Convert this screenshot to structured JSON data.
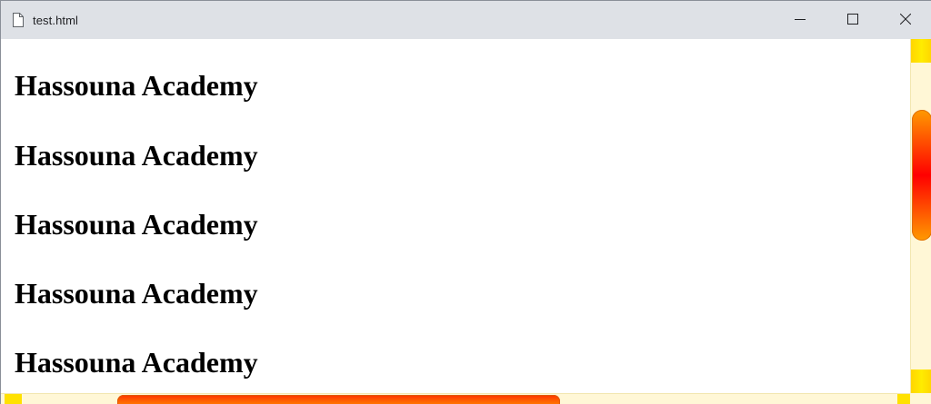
{
  "window": {
    "tab_title": "test.html",
    "icons": {
      "page": "file-icon",
      "minimize": "minimize-icon",
      "maximize": "maximize-icon",
      "close": "close-icon"
    }
  },
  "content": {
    "headings": [
      "Hassouna Academy",
      "Hassouna Academy",
      "Hassouna Academy",
      "Hassouna Academy",
      "Hassouna Academy"
    ]
  },
  "scrollbar": {
    "colors": {
      "track": "#fff7d6",
      "caps": "#ffe100",
      "thumb_center": "#ff0000",
      "thumb_edge": "#ff9a00"
    }
  }
}
